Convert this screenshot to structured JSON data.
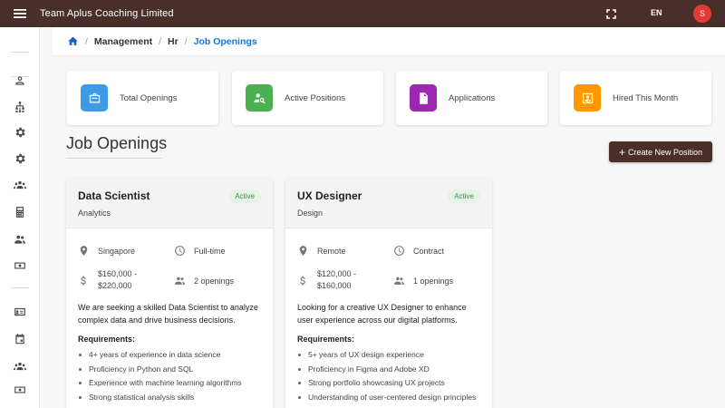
{
  "app": {
    "title": "Team Aplus Coaching Limited",
    "language": "EN",
    "user_initial": "S"
  },
  "breadcrumb": [
    "Management",
    "Hr",
    "Job Openings"
  ],
  "stats": [
    {
      "label": "Total Openings",
      "color": "#3f9ae6",
      "icon": "briefcase-icon"
    },
    {
      "label": "Active Positions",
      "color": "#4caf50",
      "icon": "person-search-icon"
    },
    {
      "label": "Applications",
      "color": "#9c27b0",
      "icon": "document-icon"
    },
    {
      "label": "Hired This Month",
      "color": "#ff9800",
      "icon": "person-check-icon"
    }
  ],
  "page": {
    "title": "Job Openings",
    "create_label": "Create New Position"
  },
  "sidebar_icons": [
    "person-icon",
    "org-chart-icon",
    "gear-icon",
    "gear-icon",
    "team-icon",
    "calculator-icon",
    "group-icon",
    "cash-icon",
    "id-card-icon",
    "calendar-icon",
    "group-icon",
    "cash-icon"
  ],
  "jobs": [
    {
      "title": "Data Scientist",
      "department": "Analytics",
      "status": "Active",
      "location": "Singapore",
      "type": "Full-time",
      "salary_line1": "$160,000 -",
      "salary_line2": "$220,000",
      "openings": "2 openings",
      "description": "We are seeking a skilled Data Scientist to analyze complex data and drive business decisions.",
      "requirements_label": "Requirements:",
      "requirements": [
        "4+ years of experience in data science",
        "Proficiency in Python and SQL",
        "Experience with machine learning algorithms",
        "Strong statistical analysis skills"
      ]
    },
    {
      "title": "UX Designer",
      "department": "Design",
      "status": "Active",
      "location": "Remote",
      "type": "Contract",
      "salary_line1": "$120,000 -",
      "salary_line2": "$160,000",
      "openings": "1 openings",
      "description": "Looking for a creative UX Designer to enhance user experience across our digital platforms.",
      "requirements_label": "Requirements:",
      "requirements": [
        "5+ years of UX design experience",
        "Proficiency in Figma and Adobe XD",
        "Strong portfolio showcasing UX projects",
        "Understanding of user-centered design principles"
      ]
    }
  ]
}
